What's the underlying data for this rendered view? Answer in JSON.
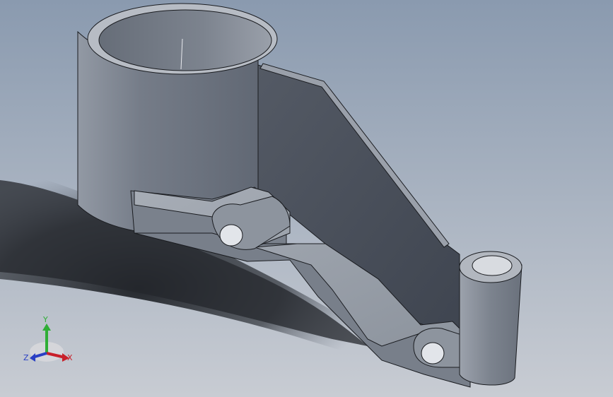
{
  "viewport": {
    "background_top": "#8b9bb0",
    "background_bottom": "#c9cdd4",
    "model_color": "#6f7684"
  },
  "triad": {
    "x_label": "X",
    "y_label": "Y",
    "z_label": "Z",
    "x_color": "#c8202a",
    "y_color": "#2fae36",
    "z_color": "#2a3fc4"
  }
}
